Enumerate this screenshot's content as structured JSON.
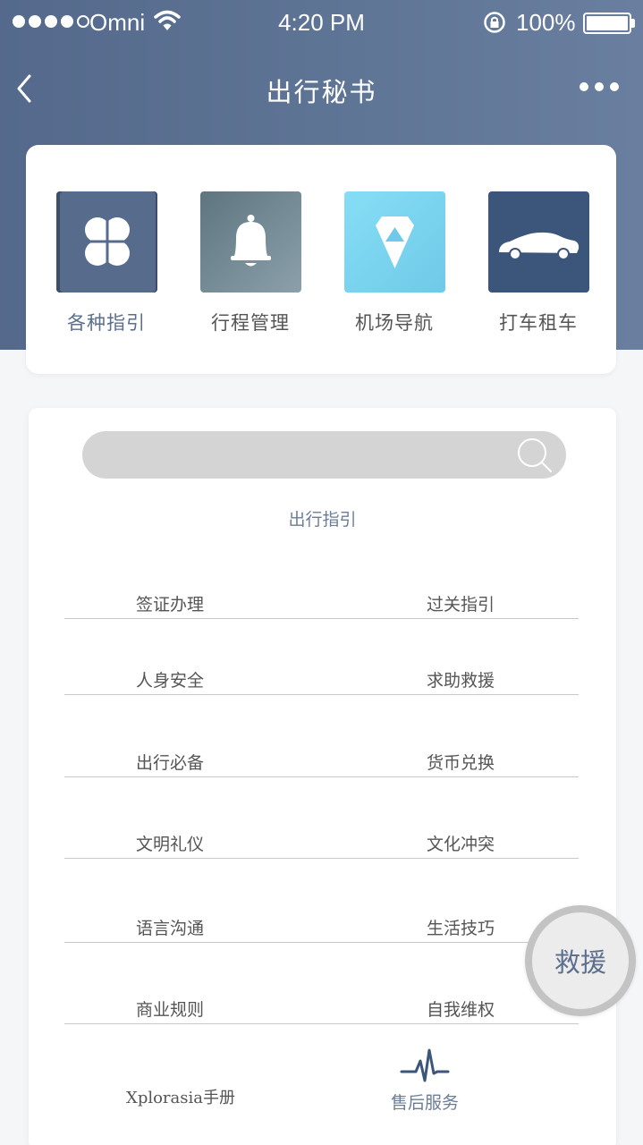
{
  "status_bar": {
    "carrier": "Omni",
    "time": "4:20 PM",
    "battery": "100%"
  },
  "nav": {
    "title": "出行秘书"
  },
  "features": [
    {
      "label": "各种指引",
      "icon": "clover-icon",
      "active": true
    },
    {
      "label": "行程管理",
      "icon": "bell-icon",
      "active": false
    },
    {
      "label": "机场导航",
      "icon": "diamond-icon",
      "active": false
    },
    {
      "label": "打车租车",
      "icon": "car-icon",
      "active": false
    }
  ],
  "search": {
    "placeholder": ""
  },
  "guide": {
    "section_title": "出行指引",
    "rows": [
      {
        "left": "签证办理",
        "right": "过关指引"
      },
      {
        "left": "人身安全",
        "right": "求助救援"
      },
      {
        "left": "出行必备",
        "right": "货币兑换"
      },
      {
        "left": "文明礼仪",
        "right": "文化冲突"
      },
      {
        "left": "语言沟通",
        "right": "生活技巧"
      },
      {
        "left": "商业规则",
        "right": "自我维权"
      }
    ],
    "footer_left": "Xplorasia手册",
    "footer_right": "售后服务"
  },
  "rescue_button": "救援",
  "colors": {
    "header": "#5f7596",
    "accent": "#5b6f8d",
    "search_bg": "#d4d4d4"
  }
}
